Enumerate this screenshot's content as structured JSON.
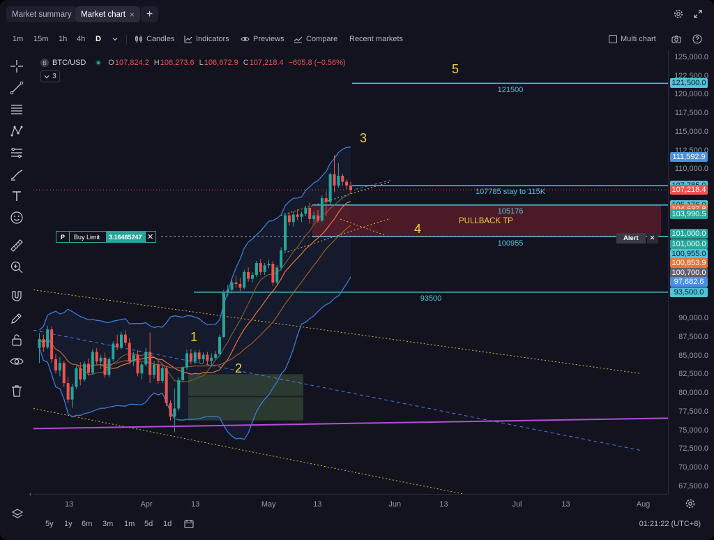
{
  "tabs": [
    {
      "label": "Market summary",
      "active": false
    },
    {
      "label": "Market chart",
      "active": true,
      "close": "×"
    }
  ],
  "tab_add": "+",
  "toolbar": {
    "intervals": [
      "1m",
      "15m",
      "1h",
      "4h",
      "D"
    ],
    "selected_interval": "D",
    "candles": "Candles",
    "indicators": "Indicators",
    "previews": "Previews",
    "compare": "Compare",
    "recent": "Recent markets",
    "multi": "Multi chart"
  },
  "legend": {
    "symbol_badge": "B",
    "symbol": "BTC/USD",
    "o_k": "O",
    "o": "107,824.2",
    "h_k": "H",
    "h": "108,273.6",
    "l_k": "L",
    "l": "106,672.9",
    "c_k": "C",
    "c": "107,218.4",
    "chg": "−605.8 (−0.56%)",
    "indicators_count": "3"
  },
  "order": {
    "side": "P",
    "label": "Buy Limit",
    "qty": "3.16485247",
    "close": "✕"
  },
  "alert": {
    "label": "Alert",
    "close": "✕"
  },
  "annotations": {
    "w1": "1",
    "w2": "2",
    "w3": "3",
    "w4": "4",
    "w5": "5",
    "pullback": "PULLBACK TP",
    "z121500": "121500",
    "z107785": "107785 stay to 115K",
    "z105176": "105176",
    "z100955": "100955",
    "z93500": "93500"
  },
  "price_axis": {
    "labels": [
      {
        "text": "125,000.0",
        "price": 125000
      },
      {
        "text": "122,500.0",
        "price": 122500
      },
      {
        "text": "120,000.0",
        "price": 120000
      },
      {
        "text": "117,500.0",
        "price": 117500
      },
      {
        "text": "115,000.0",
        "price": 115000
      },
      {
        "text": "112,500.0",
        "price": 112500
      },
      {
        "text": "110,000.0",
        "price": 110000
      },
      {
        "text": "90,000.0",
        "price": 90000
      },
      {
        "text": "87,500.0",
        "price": 87500
      },
      {
        "text": "85,000.0",
        "price": 85000
      },
      {
        "text": "82,500.0",
        "price": 82500
      },
      {
        "text": "80,000.0",
        "price": 80000
      },
      {
        "text": "77,500.0",
        "price": 77500
      },
      {
        "text": "75,000.0",
        "price": 75000
      },
      {
        "text": "72,500.0",
        "price": 72500
      },
      {
        "text": "70,000.0",
        "price": 70000
      },
      {
        "text": "67,500.0",
        "price": 67500
      }
    ],
    "tags": [
      {
        "text": "121,500.0",
        "price": 121500,
        "color": "#4fc3d9",
        "fg": "#0a1a20"
      },
      {
        "text": "111,592.9",
        "price": 111592.9,
        "color": "#4a90e2",
        "fg": "#ffffff"
      },
      {
        "text": "107,785.0",
        "price": 107785,
        "color": "#4fc3d9",
        "fg": "#0a1a20"
      },
      {
        "text": "107,218.4",
        "price": 107218.4,
        "color": "#ef5350",
        "fg": "#ffffff"
      },
      {
        "text": "105,176.0",
        "price": 105176,
        "color": "#4fc3d9",
        "fg": "#0a1a20"
      },
      {
        "text": "104,637.8",
        "price": 104637.8,
        "color": "#e8743b",
        "fg": "#ffffff"
      },
      {
        "text": "103,990.5",
        "price": 103990.5,
        "color": "#26a69a",
        "fg": "#ffffff"
      },
      {
        "text": "101,000.0",
        "price": 101300,
        "color": "#26a69a",
        "fg": "#ffffff"
      },
      {
        "text": "101,000.0",
        "price": 99900,
        "color": "#26a69a",
        "fg": "#ffffff"
      },
      {
        "text": "100,955.0",
        "price": 98650,
        "color": "#4fc3d9",
        "fg": "#0a1a20"
      },
      {
        "text": "100,853.9",
        "price": 97380,
        "color": "#e8743b",
        "fg": "#ffffff"
      },
      {
        "text": "100,700.0",
        "price": 96120,
        "color": "#5d6170",
        "fg": "#ffffff"
      },
      {
        "text": "97,682.6",
        "price": 94850,
        "color": "#4a90e2",
        "fg": "#ffffff"
      },
      {
        "text": "93,500.0",
        "price": 93500,
        "color": "#4fc3d9",
        "fg": "#0a1a20"
      }
    ]
  },
  "time_axis": [
    {
      "text": "13",
      "day": 12
    },
    {
      "text": "Apr",
      "day": 31
    },
    {
      "text": "13",
      "day": 43
    },
    {
      "text": "May",
      "day": 61
    },
    {
      "text": "13",
      "day": 73
    },
    {
      "text": "Jun",
      "day": 92
    },
    {
      "text": "13",
      "day": 104
    },
    {
      "text": "Jul",
      "day": 122
    },
    {
      "text": "13",
      "day": 134
    },
    {
      "text": "Aug",
      "day": 153
    }
  ],
  "bottom": {
    "ranges": [
      "5y",
      "1y",
      "6m",
      "3m",
      "1m",
      "5d",
      "1d"
    ],
    "clock": "01:21:22 (UTC+8)"
  },
  "colors": {
    "up": "#26a69a",
    "down": "#ef5350",
    "bb": "#3e7bd6",
    "ma_orange": "#e8743b",
    "zone": "#4fc3d9",
    "yellow_dotted": "#d4b94a",
    "purple": "#b24fd6"
  },
  "chart_data": {
    "type": "candlestick",
    "symbol": "BTC/USD",
    "interval": "D",
    "ylim": [
      65000,
      127500
    ],
    "candles_ohlc": [
      [
        86000,
        88000,
        84000,
        87200
      ],
      [
        87200,
        87800,
        85500,
        86100
      ],
      [
        86100,
        89000,
        85900,
        88500
      ],
      [
        88500,
        88900,
        84000,
        84500
      ],
      [
        84500,
        85200,
        82600,
        83000
      ],
      [
        83000,
        84800,
        82200,
        84000
      ],
      [
        84000,
        84300,
        80800,
        81300
      ],
      [
        81300,
        82100,
        78600,
        79100
      ],
      [
        79100,
        81200,
        78000,
        80800
      ],
      [
        80800,
        83600,
        80500,
        83300
      ],
      [
        83300,
        84100,
        81000,
        81800
      ],
      [
        81800,
        84200,
        81500,
        83900
      ],
      [
        83900,
        84600,
        82300,
        82700
      ],
      [
        82700,
        85900,
        82400,
        85500
      ],
      [
        85500,
        86000,
        83800,
        84200
      ],
      [
        84200,
        85100,
        83200,
        84700
      ],
      [
        84700,
        85400,
        82000,
        82400
      ],
      [
        82400,
        84800,
        82100,
        84500
      ],
      [
        84500,
        86900,
        84200,
        86600
      ],
      [
        86600,
        87800,
        85700,
        86100
      ],
      [
        86100,
        88200,
        85800,
        87800
      ],
      [
        87800,
        88400,
        86300,
        86700
      ],
      [
        86700,
        87300,
        83800,
        84200
      ],
      [
        84200,
        85500,
        83600,
        85100
      ],
      [
        85100,
        85700,
        82200,
        82600
      ],
      [
        82600,
        84100,
        81800,
        83800
      ],
      [
        83800,
        86000,
        83500,
        85500
      ],
      [
        85500,
        88100,
        81300,
        82400
      ],
      [
        82400,
        84300,
        81900,
        83800
      ],
      [
        83800,
        84300,
        81200,
        81600
      ],
      [
        81600,
        83600,
        81300,
        83300
      ],
      [
        83300,
        83600,
        78200,
        78600
      ],
      [
        78600,
        79000,
        76300,
        76800
      ],
      [
        76800,
        80600,
        74700,
        77900
      ],
      [
        77900,
        82100,
        77600,
        81700
      ],
      [
        81700,
        83600,
        81400,
        83400
      ],
      [
        83400,
        85800,
        83100,
        85300
      ],
      [
        85300,
        85900,
        83800,
        84200
      ],
      [
        84200,
        85700,
        83900,
        85400
      ],
      [
        85400,
        85800,
        84000,
        84500
      ],
      [
        84500,
        85400,
        84000,
        85100
      ],
      [
        85100,
        85500,
        83800,
        84300
      ],
      [
        84300,
        85300,
        83500,
        84700
      ],
      [
        84700,
        85600,
        84400,
        85200
      ],
      [
        85200,
        87800,
        84900,
        87500
      ],
      [
        87500,
        93800,
        87300,
        93400
      ],
      [
        93400,
        94500,
        92900,
        93800
      ],
      [
        93800,
        95200,
        93300,
        94800
      ],
      [
        94800,
        95700,
        94100,
        94600
      ],
      [
        94600,
        95400,
        93600,
        94100
      ],
      [
        94100,
        96500,
        93900,
        96200
      ],
      [
        96200,
        96800,
        94900,
        95300
      ],
      [
        95300,
        96200,
        94800,
        95800
      ],
      [
        95800,
        97700,
        95500,
        97400
      ],
      [
        97400,
        97900,
        95800,
        96200
      ],
      [
        96200,
        97400,
        95800,
        97100
      ],
      [
        97100,
        97800,
        96700,
        97300
      ],
      [
        97300,
        97700,
        94300,
        94800
      ],
      [
        94800,
        97100,
        94500,
        96800
      ],
      [
        96800,
        99500,
        96400,
        99100
      ],
      [
        99100,
        104100,
        98900,
        103800
      ],
      [
        103800,
        104200,
        102400,
        102900
      ],
      [
        102900,
        104300,
        102300,
        103900
      ],
      [
        103900,
        104600,
        103100,
        103600
      ],
      [
        103600,
        104300,
        102900,
        104000
      ],
      [
        104000,
        105100,
        103700,
        104800
      ],
      [
        104800,
        105500,
        102700,
        103300
      ],
      [
        103300,
        104300,
        102900,
        103800
      ],
      [
        103800,
        104500,
        102800,
        103100
      ],
      [
        103100,
        106500,
        102900,
        106100
      ],
      [
        106100,
        107000,
        103700,
        105600
      ],
      [
        105600,
        109500,
        105300,
        109300
      ],
      [
        109300,
        111900,
        106900,
        107800
      ],
      [
        107800,
        110800,
        107500,
        109100
      ],
      [
        109100,
        109400,
        107800,
        108300
      ],
      [
        108300,
        108600,
        107300,
        107800
      ],
      [
        107800,
        108300,
        106700,
        107200
      ]
    ],
    "levels": [
      121500,
      107785,
      105176,
      100955,
      93500
    ],
    "pullback_zone": [
      100955,
      105176
    ],
    "waves": [
      "1",
      "2",
      "3",
      "4",
      "5"
    ]
  }
}
